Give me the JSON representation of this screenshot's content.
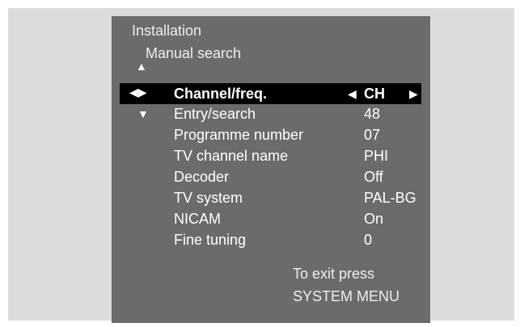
{
  "menu": {
    "title": "Installation",
    "subtitle": "Manual search",
    "selected": {
      "label": "Channel/freq.",
      "value": "CH"
    },
    "rows": [
      {
        "label": "Entry/search",
        "value": "48"
      },
      {
        "label": "Programme number",
        "value": "07"
      },
      {
        "label": "TV channel name",
        "value": "PHI"
      },
      {
        "label": "Decoder",
        "value": "Off"
      },
      {
        "label": "TV system",
        "value": "PAL-BG"
      },
      {
        "label": "NICAM",
        "value": "On"
      },
      {
        "label": "Fine tuning",
        "value": "0"
      }
    ],
    "footer": {
      "line1": "To exit press",
      "line2": "SYSTEM MENU"
    }
  },
  "icons": {
    "up": "up-triangle",
    "down": "down-triangle",
    "left_right": "left-right-triangles",
    "left": "left-triangle",
    "right": "right-triangle"
  },
  "colors": {
    "background": "#dcdcdc",
    "osd_panel": "#6b6b6b",
    "highlight": "#000000",
    "text": "#ffffff"
  }
}
